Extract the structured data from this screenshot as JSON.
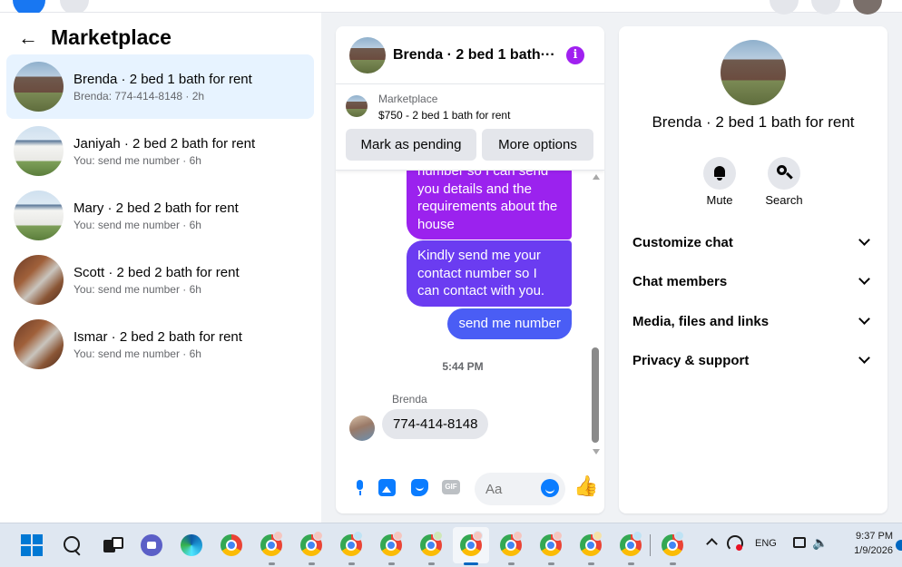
{
  "sidebar": {
    "title": "Marketplace",
    "conversations": [
      {
        "name": "Brenda · 2 bed 1 bath for rent",
        "preview": "Brenda: 774-414-8148 · 2h"
      },
      {
        "name": "Janiyah · 2 bed 2 bath for rent",
        "preview": "You: send me number · 6h"
      },
      {
        "name": "Mary · 2 bed 2 bath for rent",
        "preview": "You: send me number · 6h"
      },
      {
        "name": "Scott · 2 bed 2 bath for rent",
        "preview": "You: send me number · 6h"
      },
      {
        "name": "Ismar · 2 bed 2 bath for rent",
        "preview": "You: send me number · 6h"
      }
    ]
  },
  "chat": {
    "title": "Brenda · 2 bed 1 bath···",
    "listing": {
      "label": "Marketplace",
      "price_title": "$750 - 2 bed 1 bath for rent",
      "mark_pending": "Mark as pending",
      "more_options": "More options"
    },
    "messages": {
      "out_1": "number so I can send you details and the requirements about the house",
      "out_2": "Kindly send me your contact number so I can contact with you.",
      "out_3": "send me number",
      "time": "5:44 PM",
      "sender": "Brenda",
      "in_1": "774-414-8148"
    },
    "composer": {
      "placeholder": "Aa",
      "gif_label": "GIF"
    }
  },
  "info_panel": {
    "name": "Brenda · 2 bed 1 bath for rent",
    "actions": {
      "mute": "Mute",
      "search": "Search"
    },
    "sections": [
      "Customize chat",
      "Chat members",
      "Media, files and links",
      "Privacy & support"
    ]
  },
  "taskbar": {
    "language": "ENG",
    "time": "9:37 PM",
    "date": "1/9/2026"
  },
  "colors": {
    "accent": "#0a7cff",
    "bubble_purple": "#9b22ee",
    "bubble_violet": "#6b3cf1",
    "bubble_blue": "#4a5df5",
    "active_row": "#e7f3ff"
  }
}
